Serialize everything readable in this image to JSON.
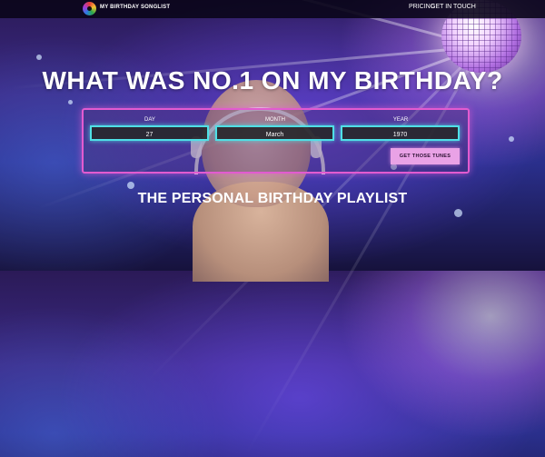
{
  "header": {
    "brand": "MY BIRTHDAY SONGLIST",
    "nav": [
      {
        "label": "PRICING"
      },
      {
        "label": "GET IN TOUCH"
      }
    ]
  },
  "hero": {
    "title": "WHAT WAS NO.1 ON MY BIRTHDAY?",
    "subtitle": "THE PERSONAL BIRTHDAY PLAYLIST"
  },
  "form": {
    "day_label": "DAY",
    "day_value": "27",
    "month_label": "MONTH",
    "month_value": "March",
    "year_label": "YEAR",
    "year_value": "1970",
    "submit_label": "GET THOSE TUNES"
  },
  "colors": {
    "accent_pink": "#e25bd0",
    "field_glow": "#4fe0e6",
    "button": "#e9a2e6"
  }
}
